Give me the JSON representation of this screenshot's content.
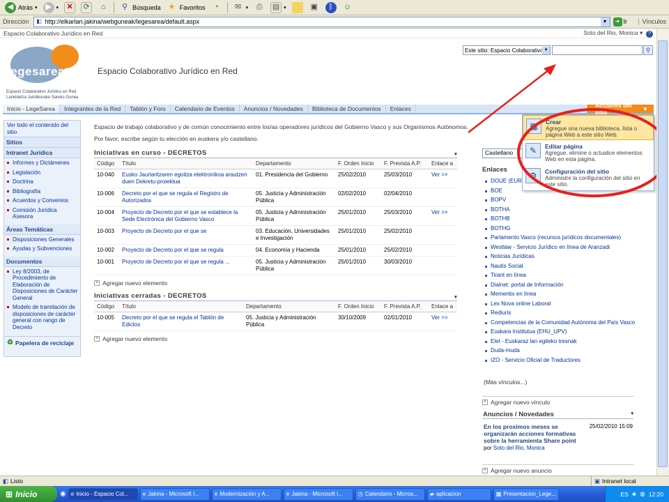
{
  "ie": {
    "back_label": "Atrás",
    "search_label": "Búsqueda",
    "favorites_label": "Favoritos",
    "address_label": "Dirección",
    "url": "http://elkarlan.jakina/webguneak/legesarea/default.aspx",
    "go_label": "Ir",
    "links_label": "Vínculos",
    "status_text": "Listo",
    "zone_text": "Intranet local"
  },
  "sp": {
    "site_name": "Espacio Colaborativo Jurídico en Red",
    "user_name": "Soto del Rio, Monica",
    "logo_text": "legesarea",
    "logo_sub1": "Espacio Colaborativo Jurídico en Red",
    "logo_sub2": "Lankidetza Juridikorako Sareko Gunea",
    "site_title": "Espacio Colaborativo Jurídico en Red",
    "search_scope": "Este sitio: Espacio Colaborativo",
    "site_actions": "Acciones del sitio"
  },
  "topnav": [
    "Inicio - LegeSarea",
    "Integrantes de la Red",
    "Tablón y Foro",
    "Calendario de Eventos",
    "Anuncios / Novedades",
    "Biblioteca de Documentos",
    "Enlaces"
  ],
  "leftnav": {
    "view_all": "Ver todo el contenido del sitio",
    "sites": "Sitios",
    "intranet_head": "Intranet Jurídica",
    "intranet_items": [
      "Informes y Dictámenes",
      "Legislación",
      "Doctrina",
      "Bibliografía",
      "Acuerdos y Convenios",
      "Comisión Jurídica Asesora"
    ],
    "areas_head": "Áreas Temáticas",
    "areas_items": [
      "Disposiciones Generales",
      "Ayudas y Subvenciones"
    ],
    "docs_head": "Documentos",
    "docs_items": [
      "Ley 8/2003, de Procedimiento de Elaboración de Disposiciones de Carácter General",
      "Modelo de tramitación de disposiciones de carácter general con rango de Decreto"
    ],
    "recycle": "Papelera de reciclaje"
  },
  "intro": {
    "line1": "Espacio de trabajo colaborativo y de común conocimiento entre los/as operadores jurídicos del Gobierno Vasco y sus Organismos Autónomos.",
    "line2": "Por favor, escribe según tu elección en euskera  y/o castellano."
  },
  "columns": {
    "codigo": "Código",
    "titulo": "Título",
    "departamento": "Departamento",
    "orden": "F. Orden Inicio",
    "prevista": "F. Prevista A.P.",
    "enlace": "Enlace a"
  },
  "curso": {
    "title": "Iniciativas en curso - DECRETOS",
    "rows": [
      {
        "codigo": "10-040",
        "titulo": "Eusko Jaurlaritzaren egoitza elektronikoa arautzen duen Dekretu-proiektua",
        "departamento": "01. Presidencia del Gobierno",
        "orden": "25/02/2010",
        "prevista": "25/03/2010",
        "enlace": "Ver >>"
      },
      {
        "codigo": "10-006",
        "titulo": "Decreto por el que se regula el Registro de Autorizados",
        "departamento": "05. Justicia y Administración Pública",
        "orden": "02/02/2010",
        "prevista": "02/04/2010",
        "enlace": ""
      },
      {
        "codigo": "10-004",
        "titulo": "Proyecto de Decreto por el que se establece la Sede Electrónica del Gobierno Vasco",
        "departamento": "05. Justicia y Administración Pública",
        "orden": "25/01/2010",
        "prevista": "25/03/2010",
        "enlace": "Ver >>"
      },
      {
        "codigo": "10-003",
        "titulo": "Proyecto de Decreto por el que se",
        "departamento": "03. Educación, Universidades e Investigación",
        "orden": "25/01/2010",
        "prevista": "25/02/2010",
        "enlace": ""
      },
      {
        "codigo": "10-002",
        "titulo": "Proyecto de Decreto por el que se regula",
        "departamento": "04. Economía y Hacienda",
        "orden": "25/01/2010",
        "prevista": "25/02/2010",
        "enlace": ""
      },
      {
        "codigo": "10-001",
        "titulo": "Proyecto de Decreto por el que se regula ...",
        "departamento": "05. Justicia y Administración Pública",
        "orden": "25/01/2010",
        "prevista": "30/03/2010",
        "enlace": ""
      }
    ],
    "add": "Agregar nuevo elemento"
  },
  "cerradas": {
    "title": "Iniciativas cerradas - DECRETOS",
    "rows": [
      {
        "codigo": "10-005",
        "titulo": "Decreto por el que se regula el Tablón de Edictos",
        "departamento": "05. Justicia y Administración Pública",
        "orden": "30/10/2009",
        "prevista": "02/01/2010",
        "enlace": "Ver >>"
      }
    ],
    "add": "Agregar nuevo elemento"
  },
  "right": {
    "language": "Castellano",
    "enlaces_head": "Enlaces",
    "links": [
      "DOUE (EUR-Lex)",
      "BOE",
      "BOPV",
      "BOTHA",
      "BOTHB",
      "BOTHG",
      "Parlamento Vasco (recursos jurídicos documentales)",
      "Westlaw - Servicio Jurídico en línea de Aranzadi",
      "Noticias Jurídicas",
      "Nautis Social",
      "Tirant en línea",
      "Dialnet: portal de Información",
      "Mementix en línea",
      "Lex Nova online Laboral",
      "Rediuris",
      "Competencias de la Comunidad Autónoma del País Vasco",
      "Euskara Institutua (EHU_UPV)",
      "Elet - Euskaraz lan egiteko tresnak",
      "Duda-muda",
      "IZO - Servicio Oficial de Traductores"
    ],
    "more_links": "(Más vínculos...)",
    "add_link": "Agregar nuevo vínculo",
    "anuncios_head": "Anuncios / Novedades",
    "anuncio_title": "En los proximos meses se organizarán acciones formativas sobre la herramienta Share point",
    "anuncio_date": "25/02/2010 15:09",
    "anuncio_by_prefix": "por",
    "anuncio_by": "Soto del Rio, Monica",
    "add_anuncio": "Agregar nuevo anuncio"
  },
  "menu": [
    {
      "title": "Crear",
      "desc": "Agregue una nueva biblioteca, lista o página Web a este sitio Web.",
      "icon": "create-icon"
    },
    {
      "title": "Editar página",
      "desc": "Agregue, elimine o actualice elementos Web en esta página.",
      "icon": "edit-page-icon"
    },
    {
      "title": "Configuración del sitio",
      "desc": "Administre la configuración del sitio en este sitio.",
      "icon": "settings-icon"
    }
  ],
  "taskbar": {
    "start": "Inicio",
    "tasks": [
      "Inicio - Espacio Col...",
      "Jakina - Microsoft I...",
      "Modernización y A...",
      "Jakina - Microsoft I...",
      "Calendario - Micros...",
      "aplicacion",
      "Presentacion_Lege..."
    ],
    "lang": "ES",
    "clock": "12:20"
  },
  "colors": {
    "accent_orange": "#f28c1a",
    "nav_blue": "#d7e5f7",
    "annotation_red": "#e8201c"
  }
}
